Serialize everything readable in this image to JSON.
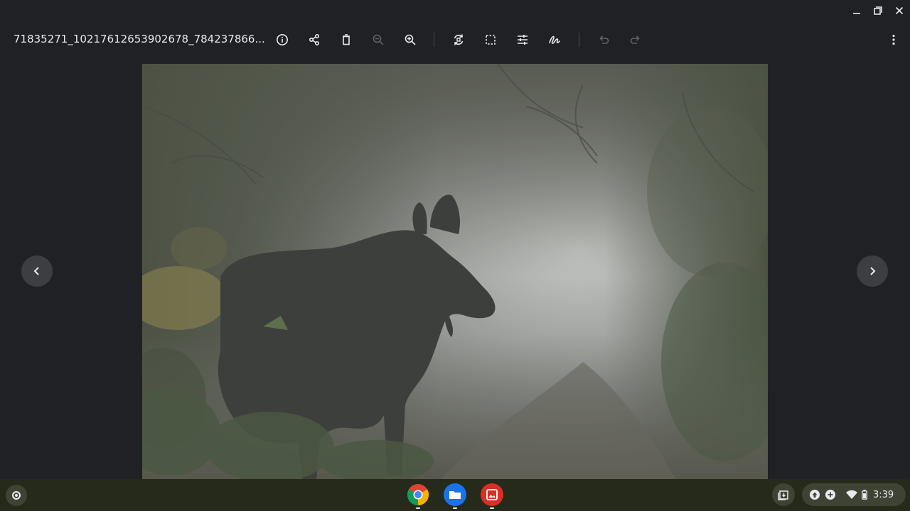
{
  "window": {
    "controls": [
      {
        "name": "minimize-button",
        "icon": "minimize-icon"
      },
      {
        "name": "restore-button",
        "icon": "restore-icon"
      },
      {
        "name": "close-button",
        "icon": "close-icon"
      }
    ]
  },
  "toolbar": {
    "filename": "71835271_10217612653902678_784237866...",
    "actions": [
      "info-icon",
      "share-icon",
      "delete-icon",
      "zoom-out-icon",
      "zoom-in-icon",
      "rotate-icon",
      "crop-icon",
      "adjust-icon",
      "annotate-icon",
      "undo-icon",
      "redo-icon",
      "more-vert-icon"
    ],
    "disabled_actions": [
      "zoom-out-icon",
      "undo-icon",
      "redo-icon"
    ]
  },
  "viewer": {
    "image_subject": "moose-in-foggy-forest-photo",
    "prev_icon": "chevron-left-icon",
    "next_icon": "chevron-right-icon"
  },
  "shelf": {
    "pinned_apps": [
      {
        "name": "chrome-app",
        "icon": "chrome-icon"
      },
      {
        "name": "files-app",
        "icon": "files-icon"
      },
      {
        "name": "gallery-app",
        "icon": "gallery-icon"
      }
    ],
    "tray_icons": [
      "holding-space-icon",
      "upload-icon",
      "add-icon",
      "wifi-icon",
      "battery-icon"
    ],
    "time": "3:39"
  },
  "colors": {
    "background": "#202124",
    "icon": "#e8eaed",
    "icon_disabled": "#5f6368",
    "shelf": "#252a1a"
  }
}
